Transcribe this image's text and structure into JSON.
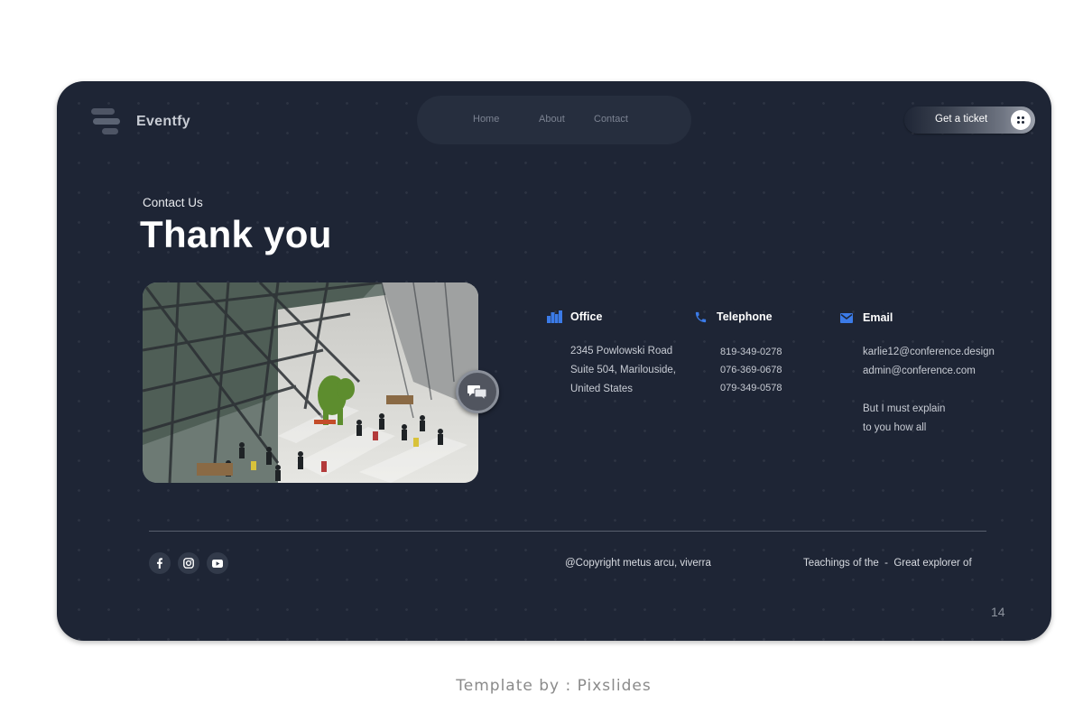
{
  "brand": {
    "name": "Eventfy",
    "logo_icon": "stacked-bars-logo"
  },
  "nav": {
    "items": [
      "Home",
      "About",
      "Contact"
    ]
  },
  "cta": {
    "label": "Get a ticket",
    "icon": "grid-dots-icon"
  },
  "heading": {
    "kicker": "Contact Us",
    "title": "Thank you"
  },
  "photo": {
    "description_icon": "photo",
    "overlay_icon": "chat-bubbles-icon"
  },
  "contacts": {
    "office": {
      "title": "Office",
      "icon": "building-icon",
      "lines": [
        "2345 Powlowski Road",
        "Suite 504, Marilouside,",
        "United States"
      ]
    },
    "telephone": {
      "title": "Telephone",
      "icon": "phone-icon",
      "lines": [
        "819-349-0278",
        "076-369-0678",
        "079-349-0578"
      ]
    },
    "email": {
      "title": "Email",
      "icon": "mail-icon",
      "lines": [
        "karlie12@conference.design",
        "admin@conference.com"
      ],
      "note": [
        "But I must explain",
        "to you how all"
      ]
    }
  },
  "footer": {
    "social": [
      "facebook-icon",
      "instagram-icon",
      "youtube-icon"
    ],
    "copyright": "@Copyright metus arcu, viverra",
    "tagline": "Teachings of the  -  Great explorer of",
    "page_number": "14"
  },
  "credit": "Template by : Pixslides",
  "colors": {
    "slide_bg": "#1e2535",
    "accent": "#3b7be8",
    "nav_bg": "#262e3e"
  }
}
